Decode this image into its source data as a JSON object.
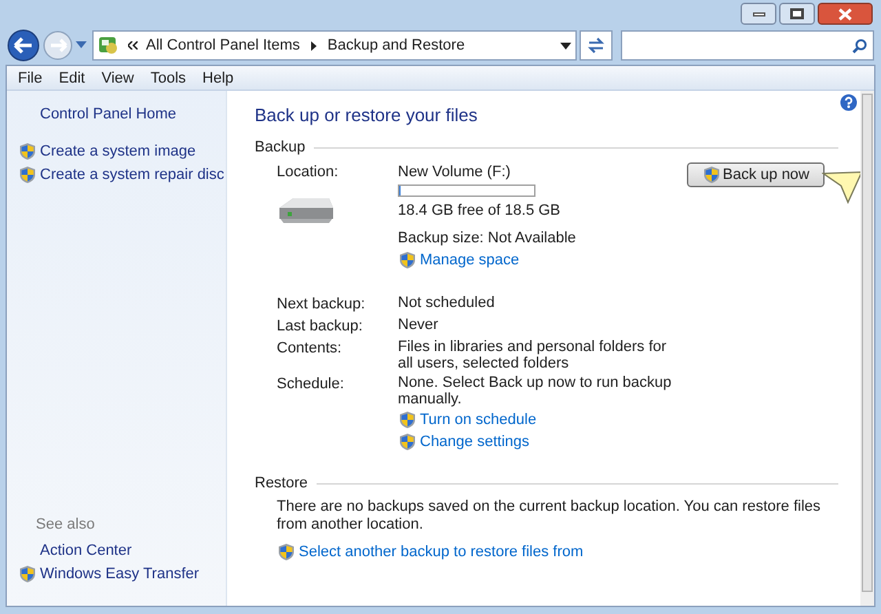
{
  "address_bar": {
    "breadcrumbs": [
      "All Control Panel Items",
      "Backup and Restore"
    ]
  },
  "menu": [
    "File",
    "Edit",
    "View",
    "Tools",
    "Help"
  ],
  "sidebar": {
    "items": [
      {
        "label": "Control Panel Home",
        "shield": false
      },
      {
        "label": "Create a system image",
        "shield": true
      },
      {
        "label": "Create a system repair disc",
        "shield": true
      }
    ],
    "see_also": {
      "heading": "See also",
      "items": [
        {
          "label": "Action Center",
          "shield": false
        },
        {
          "label": "Windows Easy Transfer",
          "shield": true
        }
      ]
    }
  },
  "page_title": "Back up or restore your files",
  "backup": {
    "heading": "Backup",
    "location": {
      "label": "Location:",
      "value": "New Volume (F:)",
      "level": 0.01,
      "free": "18.4 GB free of 18.5 GB",
      "size": "Backup size: Not Available",
      "link": "Manage space"
    },
    "button": "Back up now",
    "rows": [
      {
        "label": "Next backup:",
        "lines": [
          {
            "kind": "text",
            "text": "Not scheduled"
          }
        ]
      },
      {
        "label": "Last backup:",
        "lines": [
          {
            "kind": "text",
            "text": "Never"
          }
        ]
      },
      {
        "label": "Contents:",
        "lines": [
          {
            "kind": "text",
            "text": "Files in libraries and personal folders for all users, selected folders"
          }
        ]
      },
      {
        "label": "Schedule:",
        "lines": [
          {
            "kind": "text",
            "text": "None. Select Back up now to run backup manually."
          },
          {
            "kind": "link",
            "text": "Turn on schedule"
          },
          {
            "kind": "link",
            "text": "Change settings"
          }
        ]
      }
    ]
  },
  "restore": {
    "heading": "Restore",
    "text": "There are no backups saved on the current backup location. You can restore files from another location.",
    "link": "Select another backup to restore files from"
  }
}
